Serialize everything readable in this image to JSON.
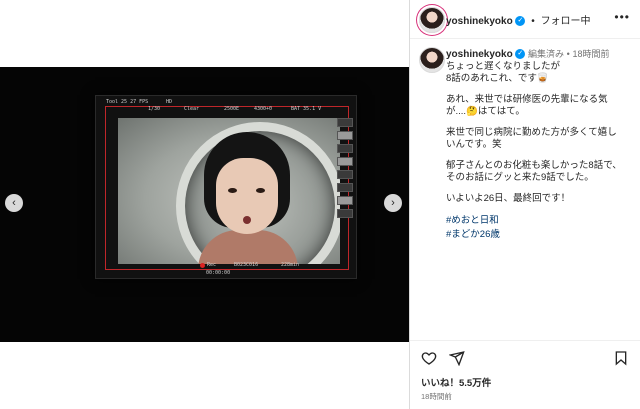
{
  "post": {
    "username": "yoshinekyoko",
    "follow_label": "フォロー中",
    "separator": "•",
    "edited_label": "編集済み",
    "time_ago": "18時間前",
    "caption_lines": [
      "ちょっと遅くなりましたが",
      "8話のあれこれ、です🥃"
    ],
    "paragraph2_lines": [
      "あれ、来世では研修医の先輩になる気",
      "が....🤔はてはて。"
    ],
    "paragraph3_lines": [
      "来世で同じ病院に勤めた方が多くて嬉し",
      "いんです。笑"
    ],
    "paragraph4_lines": [
      "郁子さんとのお化粧も楽しかった8話で、",
      "そのお話にグッと来た9話でした。"
    ],
    "paragraph5": "いよいよ26日、最終回です！",
    "hashtags": [
      "#めおと日和",
      "#まどか26歳"
    ],
    "likes": "いいね！5.5万件",
    "timestamp": "18時間前"
  },
  "monitor_hud": {
    "top_left": "HD",
    "top_mid": "1/30",
    "clear": "Clear",
    "shutter": "2500E",
    "wb": "4300+0",
    "battery": "BAT 35.1 V",
    "timecode_top": "Tool 25 27 FPS",
    "rec": "Rec",
    "clip": "B023C016",
    "remain": "228min",
    "timecode_bottom": "00:00:00"
  },
  "colors": {
    "accent_link": "#00376b",
    "verified": "#0095f6",
    "rec_frame": "#c0262a",
    "meta_gray": "#737373"
  },
  "icons": {
    "prev": "chevron-left-icon",
    "next": "chevron-right-icon",
    "like": "heart-icon",
    "share": "send-icon",
    "save": "bookmark-icon",
    "more": "more-icon"
  }
}
